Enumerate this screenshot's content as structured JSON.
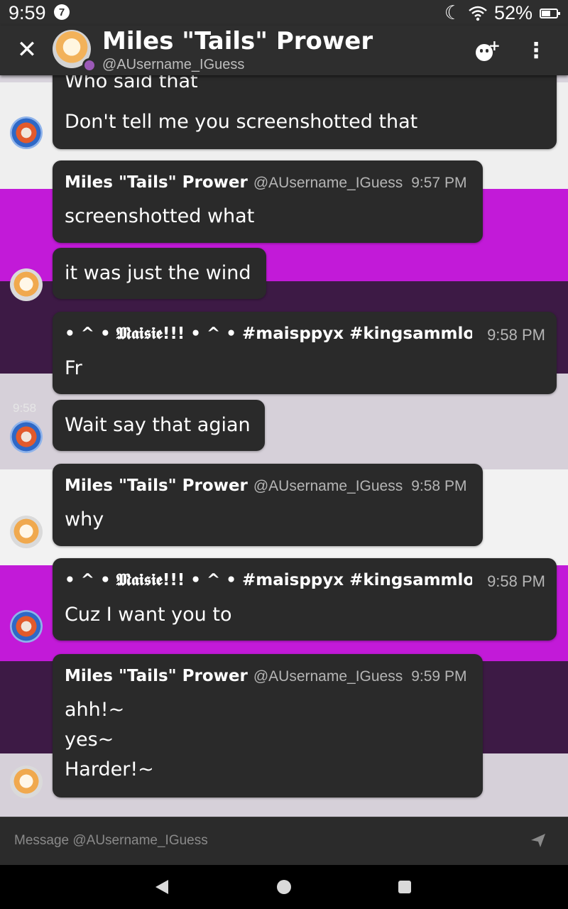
{
  "status_bar": {
    "time": "9:59",
    "notification_count": "7",
    "battery": "52%",
    "icons": [
      "moon-icon",
      "wifi-icon",
      "battery-icon"
    ]
  },
  "header": {
    "name": "Miles \"Tails\" Prower",
    "handle": "@AUsername_IGuess",
    "icons": [
      "close-icon",
      "add-friend-icon",
      "overflow-menu-icon"
    ],
    "presence_color": "#9b59b6"
  },
  "messages": [
    {
      "author": "",
      "lines": [
        "Who said that",
        "Don't tell me you screenshotted that"
      ]
    },
    {
      "author": "Miles \"Tails\" Prower",
      "handle": "@AUsername_IGuess",
      "time": "9:57 PM",
      "lines": [
        "screenshotted what"
      ]
    },
    {
      "author": "",
      "lines": [
        "it was just the wind"
      ]
    },
    {
      "author": "• ^ • 𝕸𝖆𝖎𝖘𝖎𝖊!!! • ^ • #maisppyx #kingsammlotha",
      "time": "9:58 PM",
      "lines": [
        "Fr"
      ]
    },
    {
      "side_time": "9:58",
      "lines": [
        "Wait say that agian"
      ]
    },
    {
      "author": "Miles \"Tails\" Prower",
      "handle": "@AUsername_IGuess",
      "time": "9:58 PM",
      "lines": [
        "why"
      ]
    },
    {
      "author": "• ^ • 𝕸𝖆𝖎𝖘𝖎𝖊!!! • ^ • #maisppyx #kingsammlotha",
      "time": "9:58 PM",
      "lines": [
        "Cuz I want you to"
      ]
    },
    {
      "author": "Miles \"Tails\" Prower",
      "handle": "@AUsername_IGuess",
      "time": "9:59 PM",
      "lines": [
        "ahh!~",
        "yes~",
        "Harder!~"
      ]
    }
  ],
  "composer": {
    "placeholder": "Message @AUsername_IGuess"
  },
  "colors": {
    "bubble": "#2a2a2a",
    "header": "#2e2e2e",
    "magenta_band": "#c21ad8",
    "dark_purple_band": "#3d1a45",
    "light_band": "#d6d0d9"
  }
}
